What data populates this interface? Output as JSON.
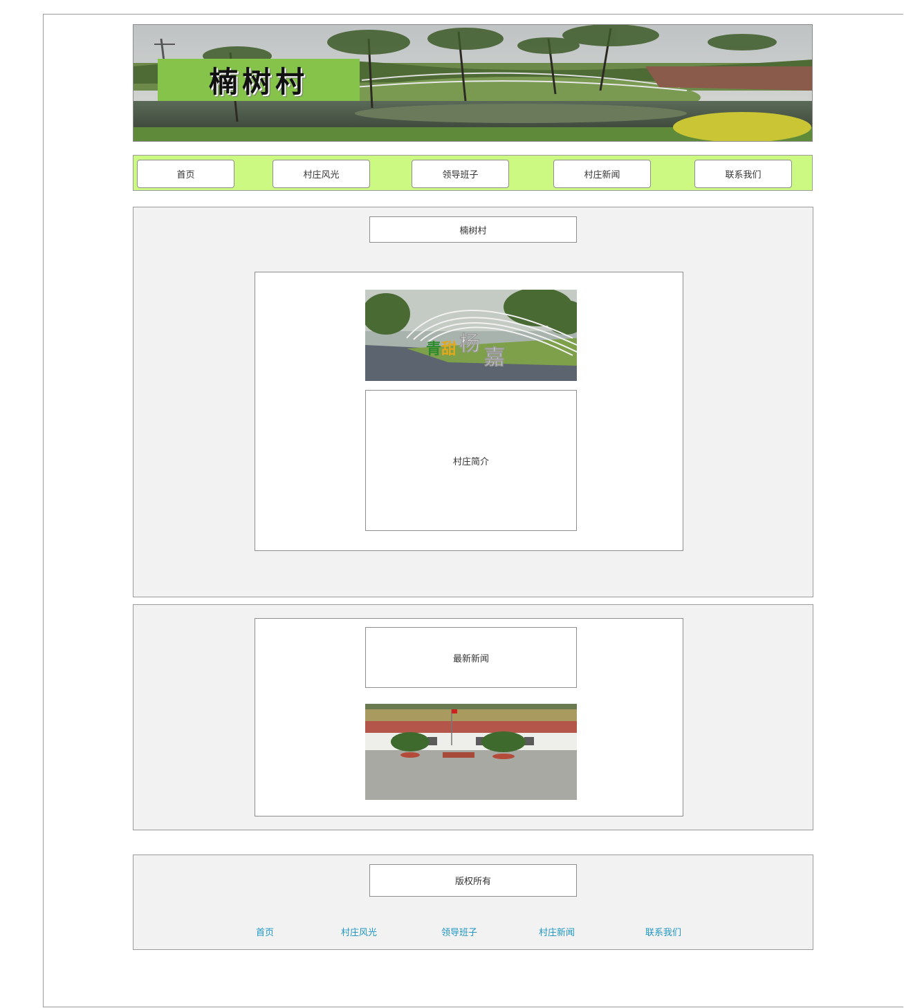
{
  "banner": {
    "title": "楠树村"
  },
  "nav": {
    "items": [
      "首页",
      "村庄风光",
      "领导班子",
      "村庄新闻",
      "联系我们"
    ]
  },
  "main": {
    "heading": "楠树村",
    "intro_label": "村庄简介",
    "intro_image_sign": "青甜杨嘉"
  },
  "news": {
    "heading": "最新新闻"
  },
  "footer": {
    "copyright": "版权所有",
    "links": [
      "首页",
      "村庄风光",
      "领导班子",
      "村庄新闻",
      "联系我们"
    ]
  },
  "colors": {
    "nav_bg": "#ccf982",
    "section_bg": "#f2f2f2",
    "title_bg": "#86c34a",
    "link": "#1f97c6"
  }
}
